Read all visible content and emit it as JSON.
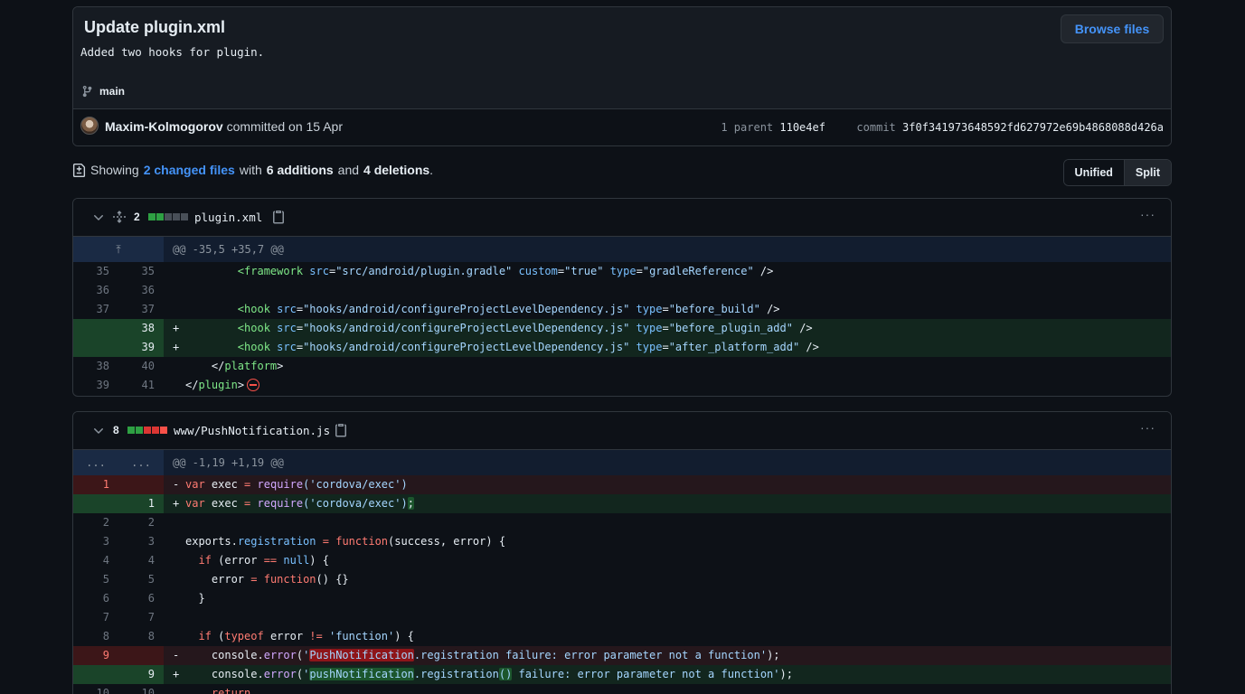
{
  "commit": {
    "title": "Update plugin.xml",
    "description": "Added two hooks for plugin.",
    "browse_label": "Browse files",
    "branch": "main",
    "author": "Maxim-Kolmogorov",
    "committed_text": "committed on 15 Apr",
    "parent_label": "1 parent",
    "parent_sha": "110e4ef",
    "commit_label": "commit",
    "commit_sha": "3f0f341973648592fd627972e69b4868088d426a"
  },
  "summary": {
    "prefix": "Showing",
    "files_link": "2 changed files",
    "with": "with",
    "additions": "6 additions",
    "and": "and",
    "deletions": "4 deletions",
    "period": "."
  },
  "view": {
    "unified": "Unified",
    "split": "Split"
  },
  "files": [
    {
      "changes": "2",
      "name": "plugin.xml",
      "diffstat": [
        "add",
        "add",
        "neutral",
        "neutral",
        "neutral"
      ],
      "hunk": "@@ -35,5 +35,7 @@",
      "lines": [
        {
          "old": "35",
          "new": "35"
        },
        {
          "old": "36",
          "new": "36"
        },
        {
          "old": "37",
          "new": "37"
        },
        {
          "old": "",
          "new": "38",
          "mark": "+"
        },
        {
          "old": "",
          "new": "39",
          "mark": "+"
        },
        {
          "old": "38",
          "new": "40"
        },
        {
          "old": "39",
          "new": "41"
        }
      ]
    },
    {
      "changes": "8",
      "name": "www/PushNotification.js",
      "diffstat": [
        "add",
        "add",
        "del",
        "del",
        "del"
      ],
      "hunk": "@@ -1,19 +1,19 @@",
      "lines": [
        {
          "old": "1",
          "new": "",
          "mark": "-"
        },
        {
          "old": "",
          "new": "1",
          "mark": "+"
        },
        {
          "old": "2",
          "new": "2"
        },
        {
          "old": "3",
          "new": "3"
        },
        {
          "old": "4",
          "new": "4"
        },
        {
          "old": "5",
          "new": "5"
        },
        {
          "old": "6",
          "new": "6"
        },
        {
          "old": "7",
          "new": "7"
        },
        {
          "old": "8",
          "new": "8"
        },
        {
          "old": "9",
          "new": "",
          "mark": "-"
        },
        {
          "old": "",
          "new": "9",
          "mark": "+"
        },
        {
          "old": "10",
          "new": "10"
        }
      ]
    }
  ],
  "code_text": {
    "f1_l1_tag": "<framework",
    "f1_l1_a1": "src",
    "f1_l1_v1": "\"src/android/plugin.gradle\"",
    "f1_l1_a2": "custom",
    "f1_l1_v2": "\"true\"",
    "f1_l1_a3": "type",
    "f1_l1_v3": "\"gradleReference\"",
    "f1_l1_end": " />",
    "hook_tag": "<hook",
    "src": "src",
    "hook_path": "\"hooks/android/configureProjectLevelDependency.js\"",
    "type": "type",
    "before_build": "\"before_build\"",
    "before_plugin_add": "\"before_plugin_add\"",
    "after_platform_add": "\"after_platform_add\"",
    "close": " />",
    "platform_close_open": "</",
    "platform": "platform",
    "gt": ">",
    "plugin_close_open": "</",
    "plugin": "plugin",
    "var": "var",
    "exec": " exec ",
    "eq": "=",
    "require": "require",
    "cordova": "('cordova/exec')",
    "semicolon": ";",
    "exports": "exports",
    "registration": "registration",
    "function": "function",
    "reg_args": "(success, error) {",
    "if": "if",
    "err_null_open": " (error ",
    "eqeq": "==",
    "null": "null",
    "paren_brace": ") {",
    "error_assign": "error ",
    "empty_fn": "() {}",
    "close_brace": "}",
    "typeof": "typeof",
    "neq": "!=",
    "func_str": "'function'",
    "console": "console",
    "error_call": "error",
    "PushNotification": "PushNotification",
    "pushNotification": "pushNotification",
    "reg_fail": " failure: error parameter not a function",
    "return": "return"
  }
}
